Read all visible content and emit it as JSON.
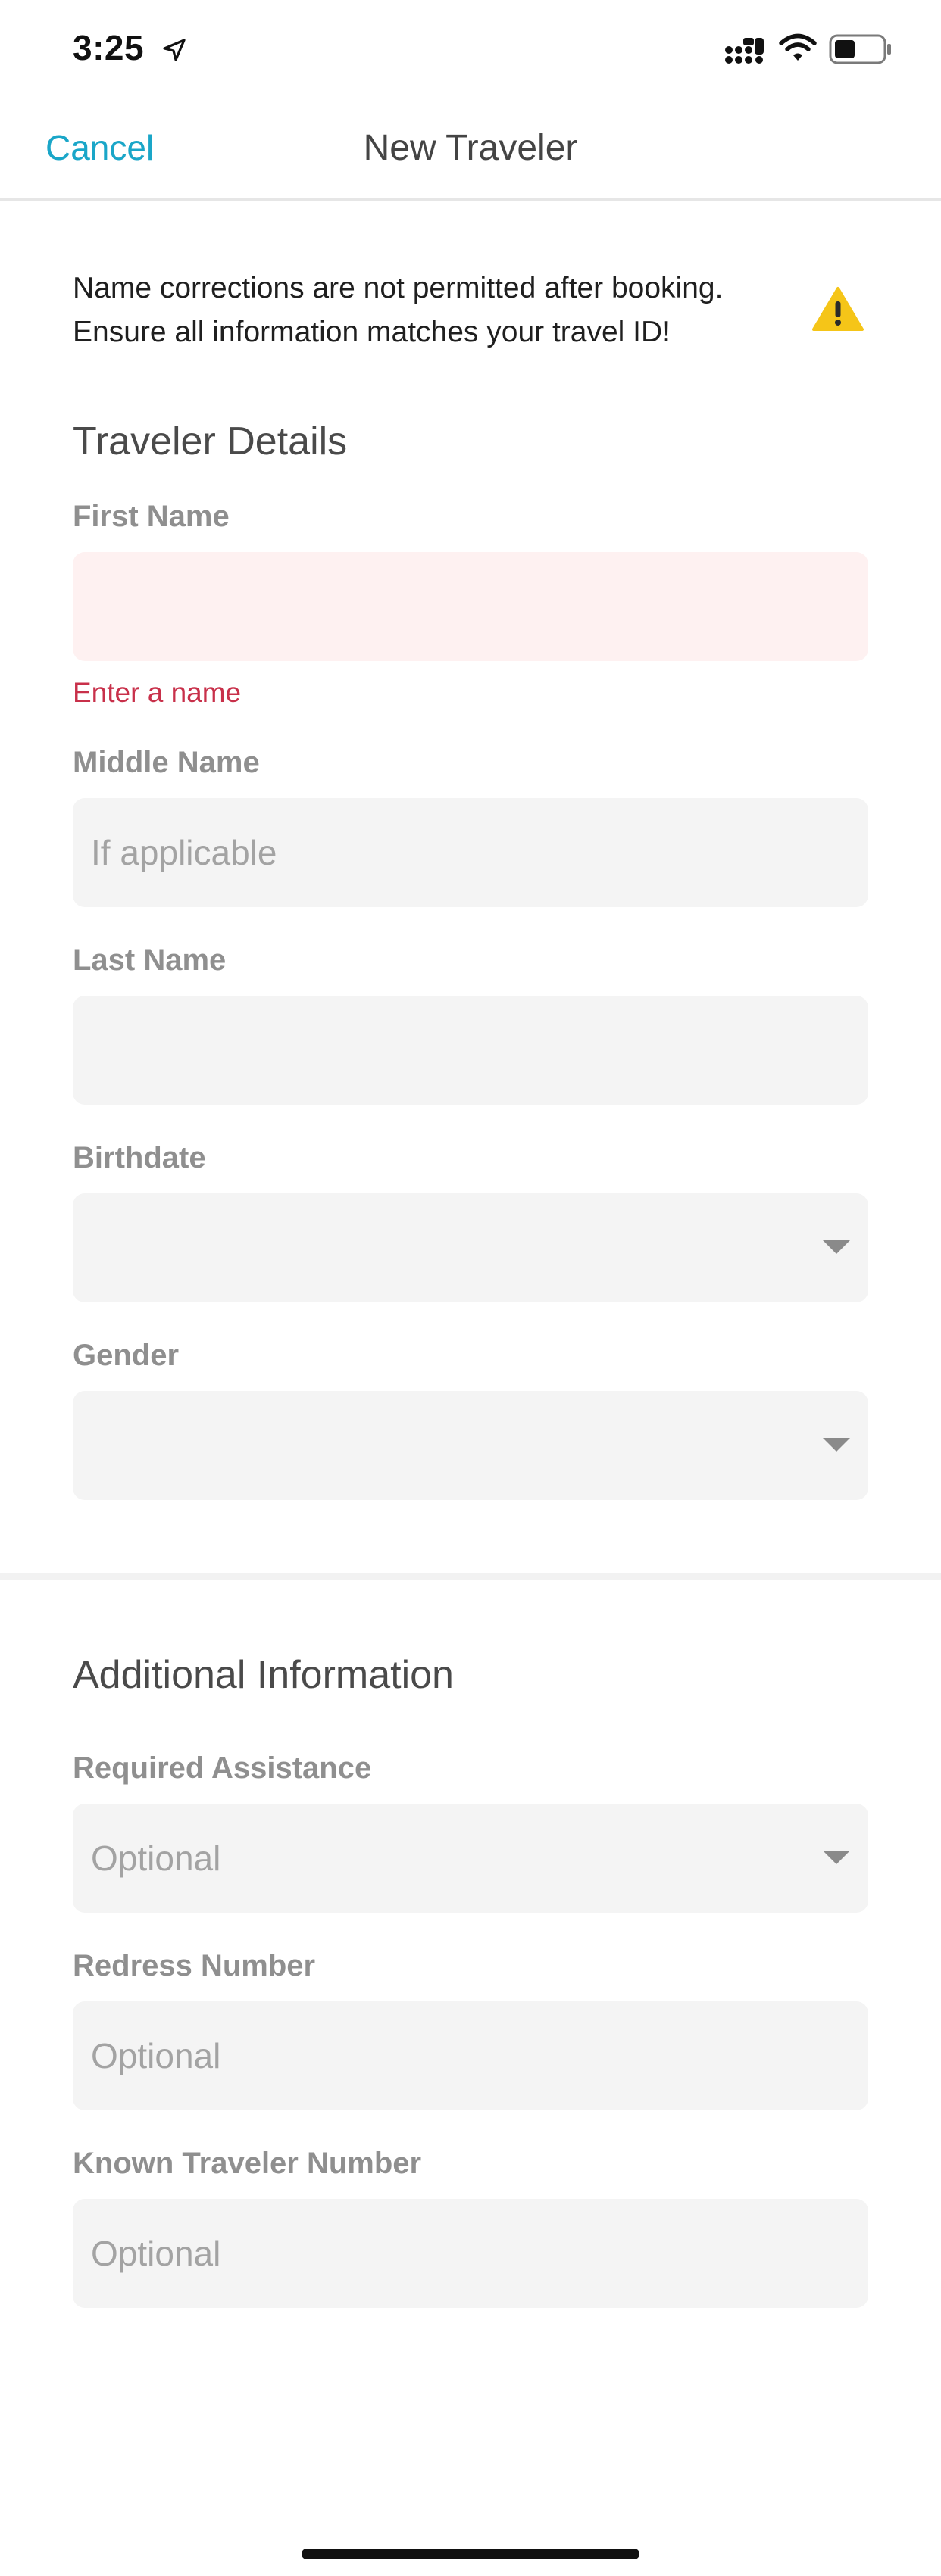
{
  "status_bar": {
    "time": "3:25",
    "icons": [
      "location-arrow-icon",
      "cellular-signal-icon",
      "wifi-icon",
      "battery-icon"
    ]
  },
  "nav": {
    "cancel_label": "Cancel",
    "title": "New Traveler"
  },
  "warning": {
    "line1": "Name corrections are not permitted after booking.",
    "line2": "Ensure all information matches your travel ID!",
    "icon": "warning-triangle-icon",
    "icon_color": "#f5c518"
  },
  "traveler_details": {
    "heading": "Traveler Details",
    "first_name": {
      "label": "First Name",
      "value": "",
      "error": "Enter a name"
    },
    "middle_name": {
      "label": "Middle Name",
      "placeholder": "If applicable"
    },
    "last_name": {
      "label": "Last Name",
      "value": ""
    },
    "birthdate": {
      "label": "Birthdate",
      "value": ""
    },
    "gender": {
      "label": "Gender",
      "value": ""
    }
  },
  "additional_info": {
    "heading": "Additional Information",
    "required_assistance": {
      "label": "Required Assistance",
      "placeholder": "Optional"
    },
    "redress_number": {
      "label": "Redress Number",
      "placeholder": "Optional"
    },
    "known_traveler_number": {
      "label": "Known Traveler Number",
      "placeholder": "Optional"
    }
  },
  "colors": {
    "accent": "#1aa6c8",
    "error": "#c8304a",
    "error_field_bg": "#fef1f1",
    "field_bg": "#f4f4f4"
  }
}
